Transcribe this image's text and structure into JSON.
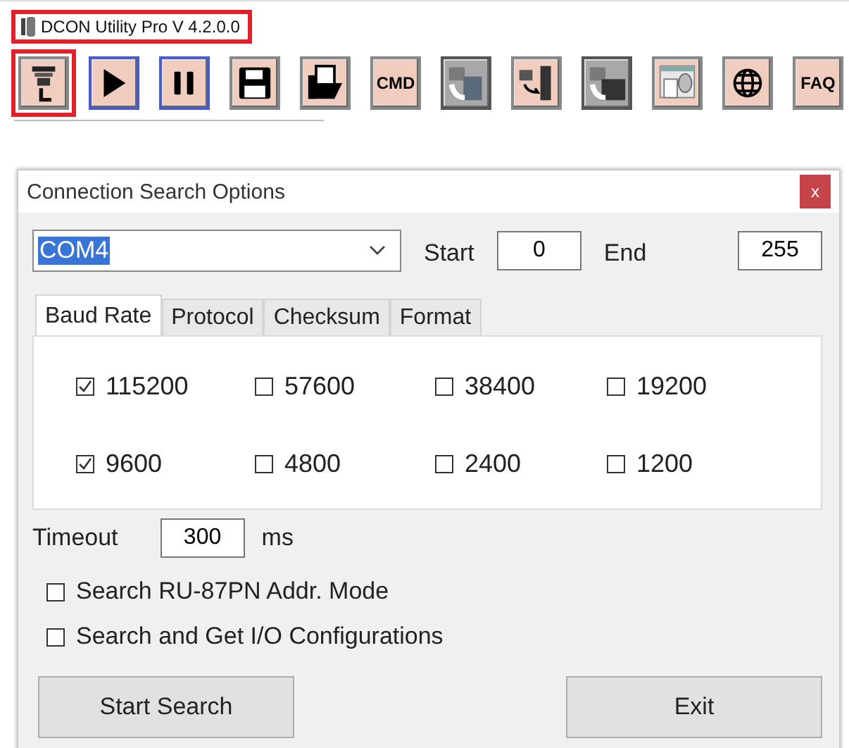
{
  "window": {
    "title": "DCON Utility Pro  V 4.2.0.0",
    "highlighted": true
  },
  "toolbar": [
    {
      "kind": "search",
      "highlighted": true
    },
    {
      "kind": "play",
      "highlighted": false
    },
    {
      "kind": "pause",
      "highlighted": false
    },
    {
      "kind": "save",
      "highlighted": false
    },
    {
      "kind": "open",
      "highlighted": false
    },
    {
      "kind": "text",
      "label": "CMD",
      "highlighted": false
    },
    {
      "kind": "module",
      "highlighted": false
    },
    {
      "kind": "transfer",
      "highlighted": false
    },
    {
      "kind": "rack",
      "highlighted": false
    },
    {
      "kind": "database",
      "highlighted": false
    },
    {
      "kind": "globe",
      "highlighted": false
    },
    {
      "kind": "text",
      "label": "FAQ",
      "highlighted": false
    }
  ],
  "dialog": {
    "title": "Connection Search Options",
    "close": "x",
    "port": {
      "value": "COM4"
    },
    "start_label": "Start",
    "start": {
      "value": "0"
    },
    "end_label": "End",
    "end": {
      "value": "255"
    },
    "tabs": [
      {
        "label": "Baud Rate",
        "selected": true
      },
      {
        "label": "Protocol",
        "selected": false
      },
      {
        "label": "Checksum",
        "selected": false
      },
      {
        "label": "Format",
        "selected": false
      }
    ],
    "baud_rates": [
      {
        "label": "115200",
        "checked": true
      },
      {
        "label": "57600",
        "checked": false
      },
      {
        "label": "38400",
        "checked": false
      },
      {
        "label": "19200",
        "checked": false
      },
      {
        "label": "9600",
        "checked": true
      },
      {
        "label": "4800",
        "checked": false
      },
      {
        "label": "2400",
        "checked": false
      },
      {
        "label": "1200",
        "checked": false
      }
    ],
    "timeout_label": "Timeout",
    "timeout": {
      "value": "300"
    },
    "timeout_unit": "ms",
    "options": [
      {
        "label": "Search RU-87PN Addr. Mode",
        "checked": false
      },
      {
        "label": "Search and Get I/O Configurations",
        "checked": false
      }
    ],
    "buttons": [
      "Start Search",
      "Exit"
    ]
  }
}
